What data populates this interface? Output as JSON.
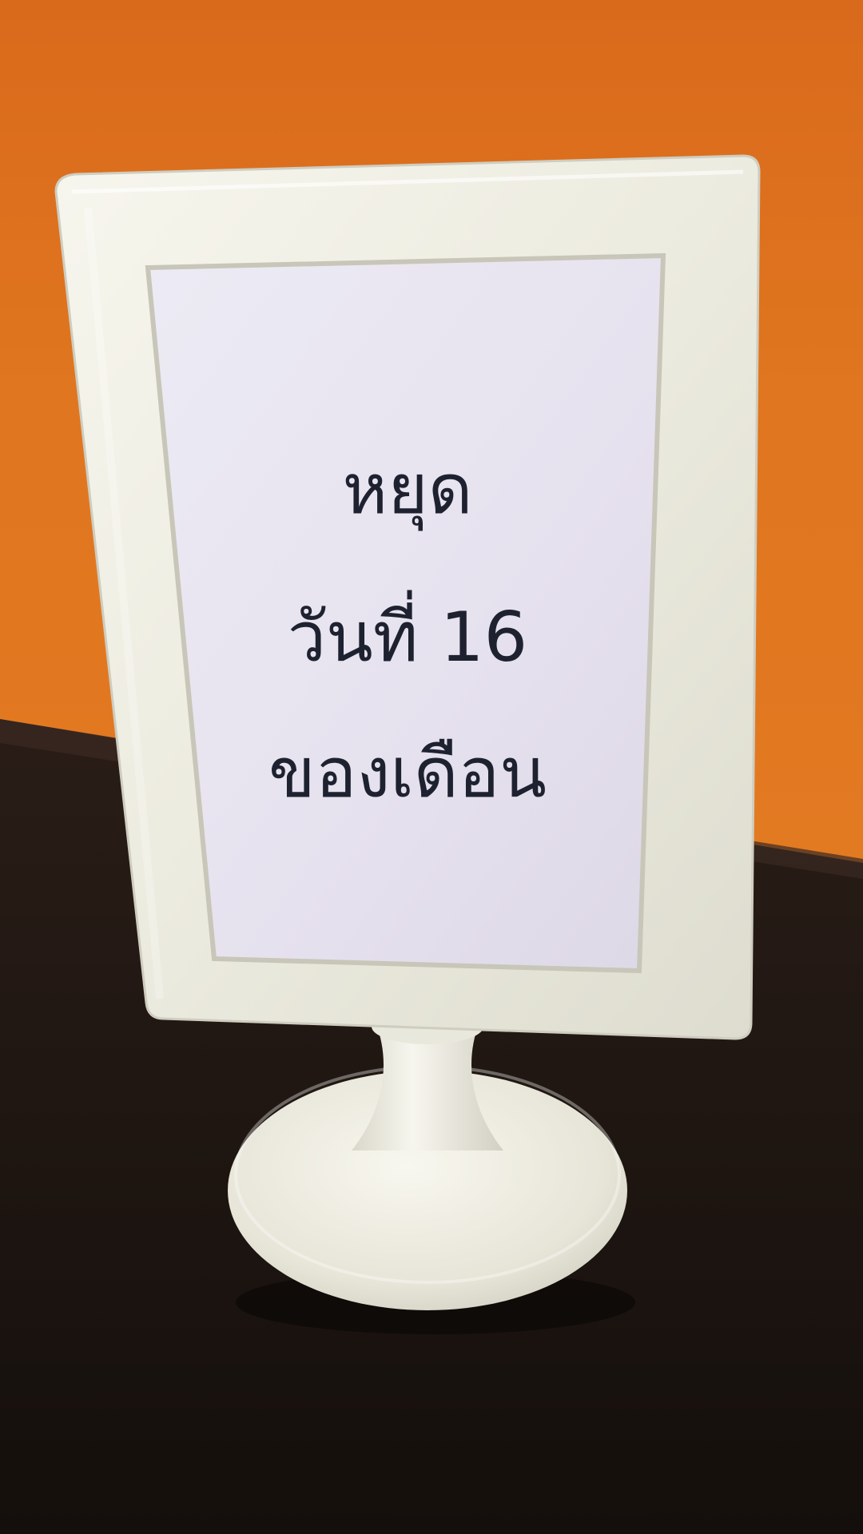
{
  "sign": {
    "line1": "หยุด",
    "line2": "วันที่ 16",
    "line3": "ของเดือน"
  },
  "colors": {
    "wall": "#e0761f",
    "table": "#1f1612",
    "frame": "#efeee3",
    "paper": "#e9e5f0",
    "text": "#1e2230"
  }
}
